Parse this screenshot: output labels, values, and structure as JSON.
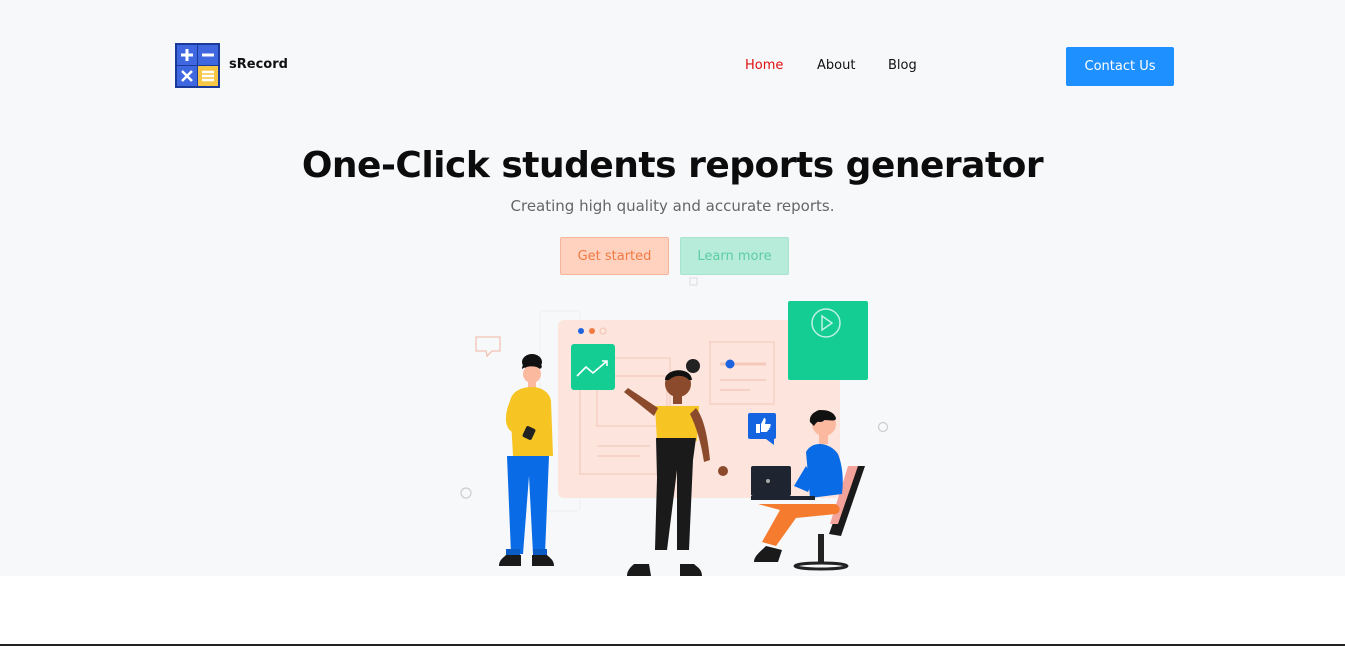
{
  "header": {
    "brand": "sRecord",
    "nav": [
      {
        "label": "Home",
        "active": true
      },
      {
        "label": "About",
        "active": false
      },
      {
        "label": "Blog",
        "active": false
      }
    ],
    "contact_label": "Contact Us"
  },
  "hero": {
    "title": "One-Click students reports generator",
    "subtitle": "Creating high quality and accurate reports.",
    "get_started_label": "Get started",
    "learn_more_label": "Learn more"
  },
  "colors": {
    "accent": "#1e90ff",
    "active_nav": "#e01010",
    "get_started_bg": "#ffd2bf",
    "learn_more_bg": "#b6ecd9",
    "hero_bg": "#f7f8fa"
  },
  "icons": [
    "calculator-logo-icon",
    "play-icon",
    "trend-chart-icon",
    "thumbs-up-icon",
    "chat-bubble-icon"
  ]
}
